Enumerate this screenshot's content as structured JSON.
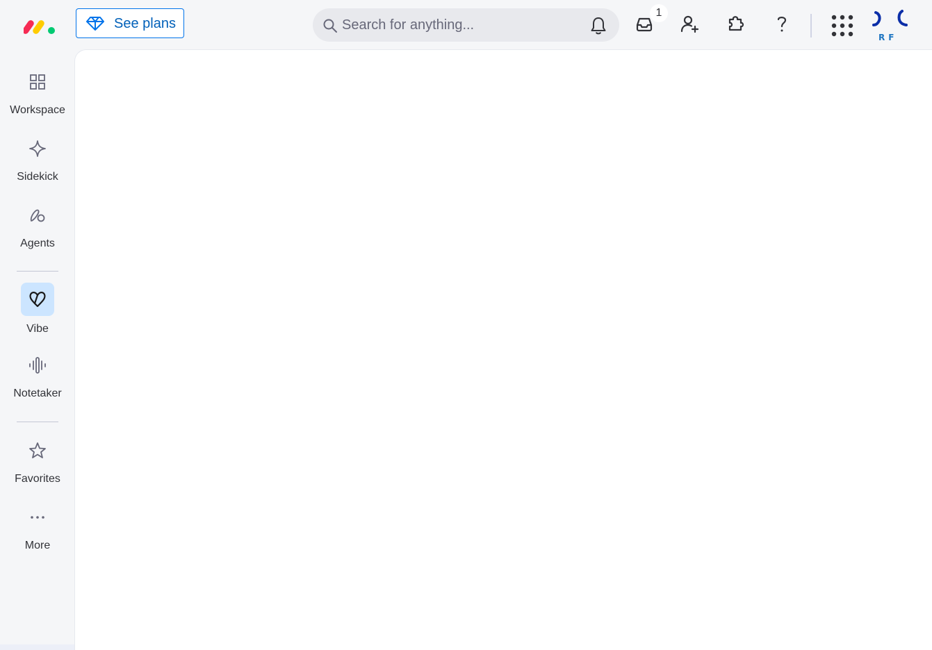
{
  "header": {
    "see_plans_label": "See plans",
    "search": {
      "placeholder": "Search for anything...",
      "value": ""
    },
    "inbox_badge_count": "1",
    "avatar_initials": "RF",
    "icons": [
      "logo-icon",
      "gem-icon",
      "search-icon",
      "bell-icon",
      "inbox-icon",
      "invite-user-icon",
      "apps-puzzle-icon",
      "help-icon",
      "apps-grid-icon",
      "avatar"
    ]
  },
  "sidebar": {
    "items": [
      {
        "label": "Workspace",
        "icon": "workspace-grid-icon"
      },
      {
        "label": "Sidekick",
        "icon": "sparkle-icon"
      },
      {
        "label": "Agents",
        "icon": "agents-icon"
      },
      {
        "label": "Vibe",
        "icon": "vibe-heart-icon",
        "selected": true
      },
      {
        "label": "Notetaker",
        "icon": "audio-wave-icon"
      },
      {
        "label": "Favorites",
        "icon": "star-icon"
      },
      {
        "label": "More",
        "icon": "more-dots-icon"
      }
    ]
  },
  "colors": {
    "accent": "#0073ea",
    "selected_bg": "#cce5ff",
    "page_bg": "#f5f6f8",
    "content_bg": "#ffffff"
  }
}
